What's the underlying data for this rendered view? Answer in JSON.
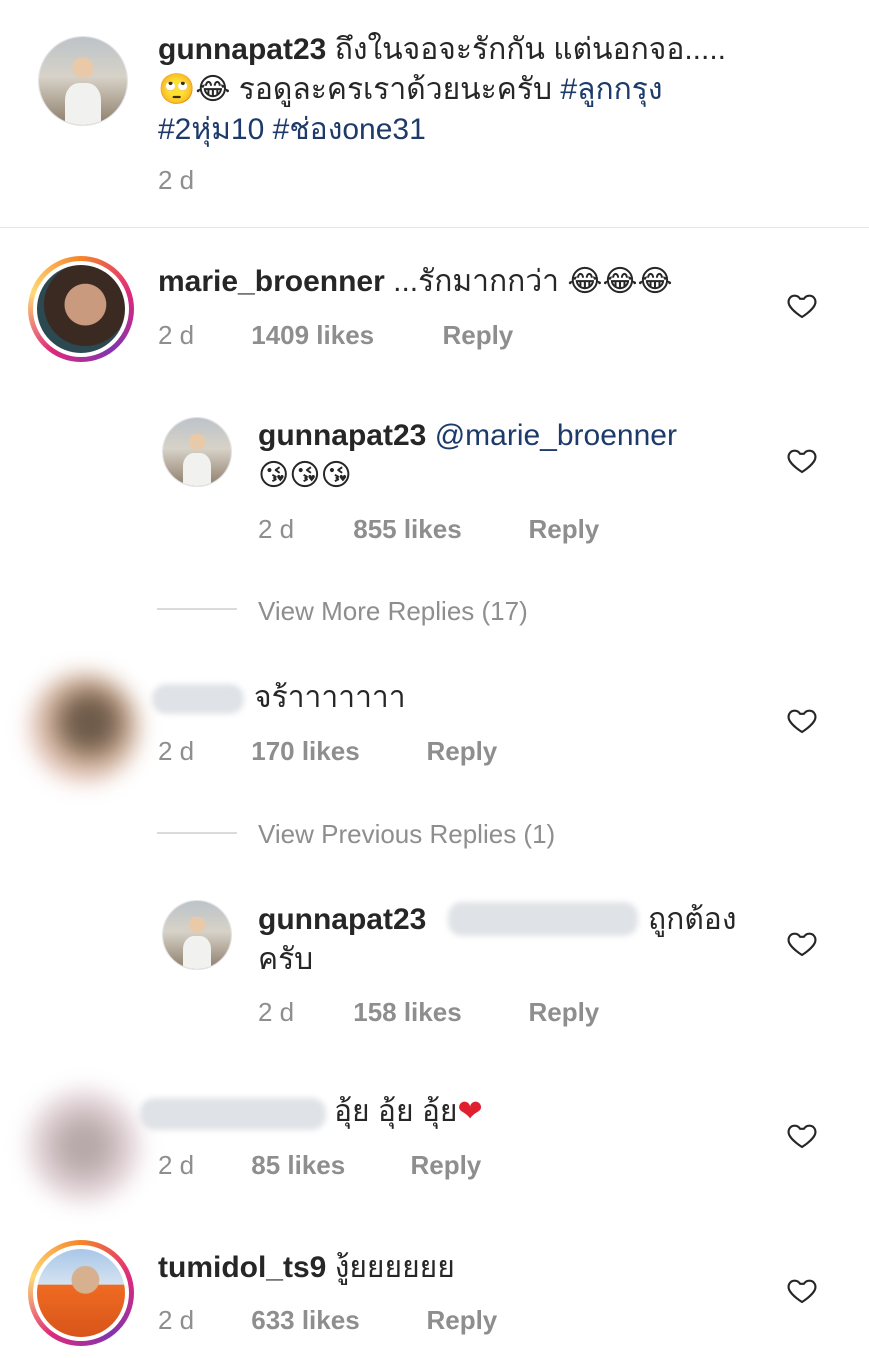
{
  "caption": {
    "username": "gunnapat23",
    "text_line1": "ถึงในจอจะรักกัน แต่นอกจอ.....",
    "emoji_line2": "🙄😂",
    "text_line2": "รอดูละครเราด้วยนะครับ",
    "tag1": "#ลูกกรุง",
    "tag2": "#2หุ่ม10",
    "tag3": "#ช่องone31",
    "time": "2 d"
  },
  "comments": [
    {
      "username": "marie_broenner",
      "text": "...รักมากกว่า",
      "emoji": "😂😂😂",
      "time": "2 d",
      "likes": "1409 likes",
      "reply_label": "Reply"
    },
    {
      "reply": true,
      "username": "gunnapat23",
      "mention": "@marie_broenner",
      "emoji": "😘😘😘",
      "time": "2 d",
      "likes": "855 likes",
      "reply_label": "Reply"
    },
    {
      "view_more": "View More Replies (17)"
    },
    {
      "text": "จร้าาาาาาา",
      "time": "2 d",
      "likes": "170 likes",
      "reply_label": "Reply"
    },
    {
      "view_previous": "View Previous Replies (1)"
    },
    {
      "reply": true,
      "username": "gunnapat23",
      "text_line1": "ถูกต้อง",
      "text_line2": "ครับ",
      "time": "2 d",
      "likes": "158 likes",
      "reply_label": "Reply"
    },
    {
      "text": "อุ้ย อุ้ย อุ้ย",
      "emoji": "❤",
      "time": "2 d",
      "likes": "85 likes",
      "reply_label": "Reply"
    },
    {
      "username": "tumidol_ts9",
      "text": "งู้ยยยยยย",
      "time": "2 d",
      "likes": "633 likes",
      "reply_label": "Reply"
    }
  ],
  "colors": {
    "hashtag": "#1d3a6b",
    "muted": "#8e8e8e",
    "heart_red": "#e0202e"
  },
  "icons": [
    "heart-outline-icon"
  ]
}
